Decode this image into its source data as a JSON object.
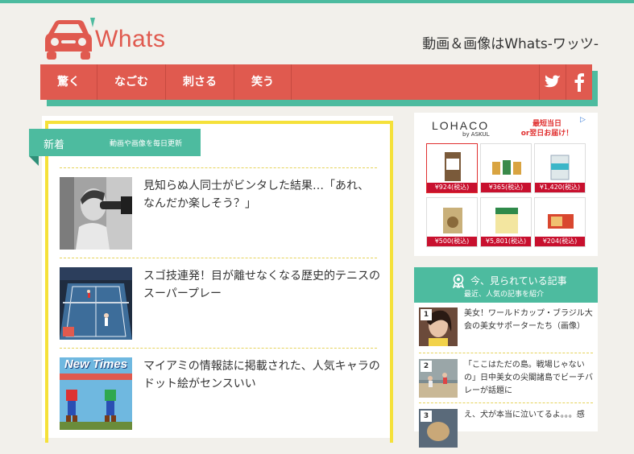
{
  "header": {
    "logo_text": "Whats",
    "tagline": "動画＆画像はWhats-ワッツ-"
  },
  "nav": {
    "items": [
      "驚く",
      "なごむ",
      "刺さる",
      "笑う"
    ],
    "social": [
      "twitter-icon",
      "facebook-icon"
    ]
  },
  "main": {
    "section_title": "新着",
    "section_subtitle": "動画や画像を毎日更新",
    "articles": [
      {
        "title": "見知らぬ人同士がビンタした結果…「あれ、なんだか楽しそう？」"
      },
      {
        "title": "スゴ技連発！目が離せなくなる歴史的テニスのスーパープレー"
      },
      {
        "title": "マイアミの情報誌に掲載された、人気キャラのドット絵がセンスいい",
        "thumb_text": "New Times"
      }
    ]
  },
  "ad": {
    "brand": "LOHACO",
    "brand_sub": "by ASKUL",
    "promo_line1": "最短当日",
    "promo_line2": "or翌日お届け！",
    "close": "▷",
    "items": [
      {
        "price": "¥924(税込)"
      },
      {
        "price": "¥365(税込)"
      },
      {
        "price": "¥1,420(税込)"
      },
      {
        "price": "¥500(税込)"
      },
      {
        "price": "¥5,801(税込)"
      },
      {
        "price": "¥204(税込)"
      }
    ]
  },
  "popular": {
    "title": "今、見られている記事",
    "subtitle": "最近、人気の記事を紹介",
    "items": [
      {
        "rank": "1",
        "title": "美女！ワールドカップ・ブラジル大会の美女サポーターたち（画像）"
      },
      {
        "rank": "2",
        "title": "「ここはただの島。戦場じゃないの」日中美女の尖閣諸島でビーチバレーが話題に"
      },
      {
        "rank": "3",
        "title": "え、犬が本当に泣いてるよ。。。感"
      }
    ]
  },
  "colors": {
    "accent_red": "#e05a4f",
    "accent_teal": "#4dbb9f",
    "accent_yellow": "#f5e13a",
    "background": "#f2f0eb"
  }
}
